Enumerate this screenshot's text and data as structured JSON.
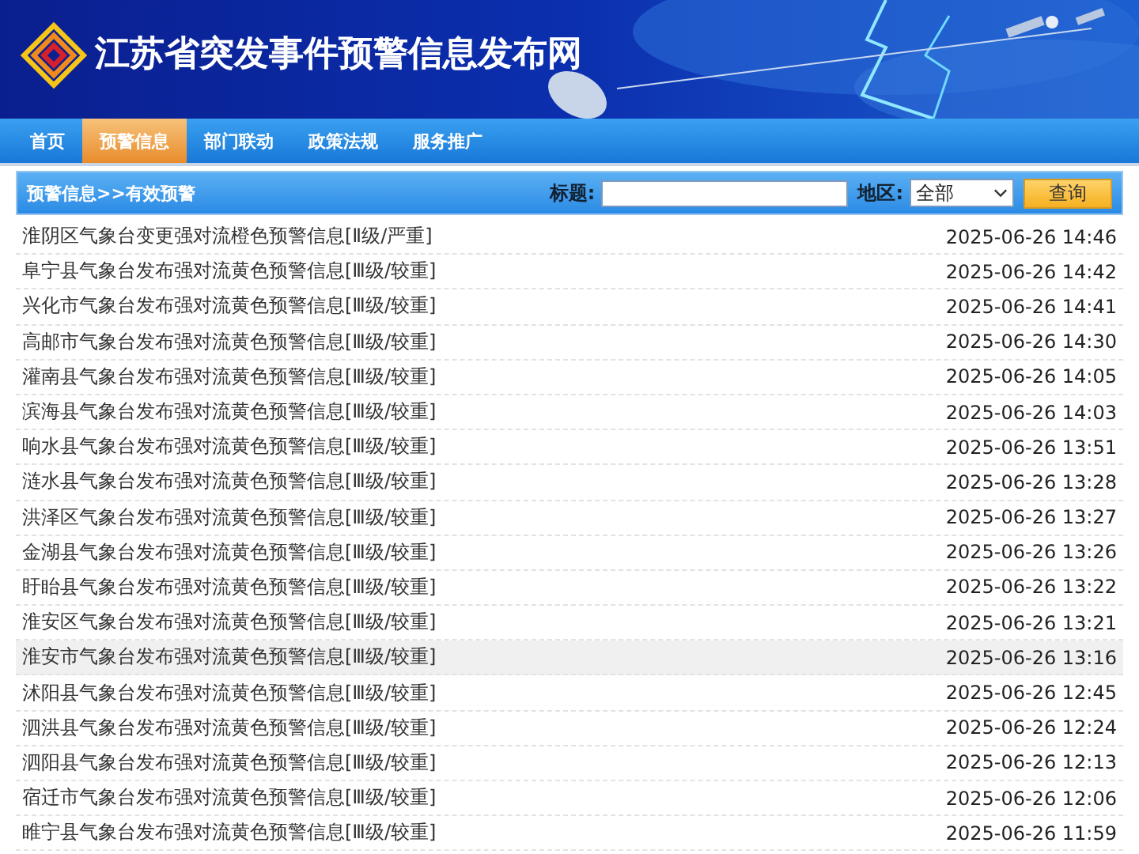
{
  "header": {
    "title": "江苏省突发事件预警信息发布网"
  },
  "nav": [
    {
      "label": "首页",
      "selected": false
    },
    {
      "label": "预警信息",
      "selected": true
    },
    {
      "label": "部门联动",
      "selected": false
    },
    {
      "label": "政策法规",
      "selected": false
    },
    {
      "label": "服务推广",
      "selected": false
    }
  ],
  "toolbar": {
    "breadcrumb": "预警信息>>有效预警",
    "title_label": "标题:",
    "region_label": "地区:",
    "region_select": "全部",
    "search_button": "查询"
  },
  "rows": [
    {
      "title": "淮阴区气象台变更强对流橙色预警信息[Ⅱ级/严重]",
      "time": "2025-06-26 14:46",
      "hovered": false
    },
    {
      "title": "阜宁县气象台发布强对流黄色预警信息[Ⅲ级/较重]",
      "time": "2025-06-26 14:42",
      "hovered": false
    },
    {
      "title": "兴化市气象台发布强对流黄色预警信息[Ⅲ级/较重]",
      "time": "2025-06-26 14:41",
      "hovered": false
    },
    {
      "title": "高邮市气象台发布强对流黄色预警信息[Ⅲ级/较重]",
      "time": "2025-06-26 14:30",
      "hovered": false
    },
    {
      "title": "灌南县气象台发布强对流黄色预警信息[Ⅲ级/较重]",
      "time": "2025-06-26 14:05",
      "hovered": false
    },
    {
      "title": "滨海县气象台发布强对流黄色预警信息[Ⅲ级/较重]",
      "time": "2025-06-26 14:03",
      "hovered": false
    },
    {
      "title": "响水县气象台发布强对流黄色预警信息[Ⅲ级/较重]",
      "time": "2025-06-26 13:51",
      "hovered": false
    },
    {
      "title": "涟水县气象台发布强对流黄色预警信息[Ⅲ级/较重]",
      "time": "2025-06-26 13:28",
      "hovered": false
    },
    {
      "title": "洪泽区气象台发布强对流黄色预警信息[Ⅲ级/较重]",
      "time": "2025-06-26 13:27",
      "hovered": false
    },
    {
      "title": "金湖县气象台发布强对流黄色预警信息[Ⅲ级/较重]",
      "time": "2025-06-26 13:26",
      "hovered": false
    },
    {
      "title": "盱眙县气象台发布强对流黄色预警信息[Ⅲ级/较重]",
      "time": "2025-06-26 13:22",
      "hovered": false
    },
    {
      "title": "淮安区气象台发布强对流黄色预警信息[Ⅲ级/较重]",
      "time": "2025-06-26 13:21",
      "hovered": false
    },
    {
      "title": "淮安市气象台发布强对流黄色预警信息[Ⅲ级/较重]",
      "time": "2025-06-26 13:16",
      "hovered": true
    },
    {
      "title": "沭阳县气象台发布强对流黄色预警信息[Ⅲ级/较重]",
      "time": "2025-06-26 12:45",
      "hovered": false
    },
    {
      "title": "泗洪县气象台发布强对流黄色预警信息[Ⅲ级/较重]",
      "time": "2025-06-26 12:24",
      "hovered": false
    },
    {
      "title": "泗阳县气象台发布强对流黄色预警信息[Ⅲ级/较重]",
      "time": "2025-06-26 12:13",
      "hovered": false
    },
    {
      "title": "宿迁市气象台发布强对流黄色预警信息[Ⅲ级/较重]",
      "time": "2025-06-26 12:06",
      "hovered": false
    },
    {
      "title": "睢宁县气象台发布强对流黄色预警信息[Ⅲ级/较重]",
      "time": "2025-06-26 11:59",
      "hovered": false
    }
  ]
}
